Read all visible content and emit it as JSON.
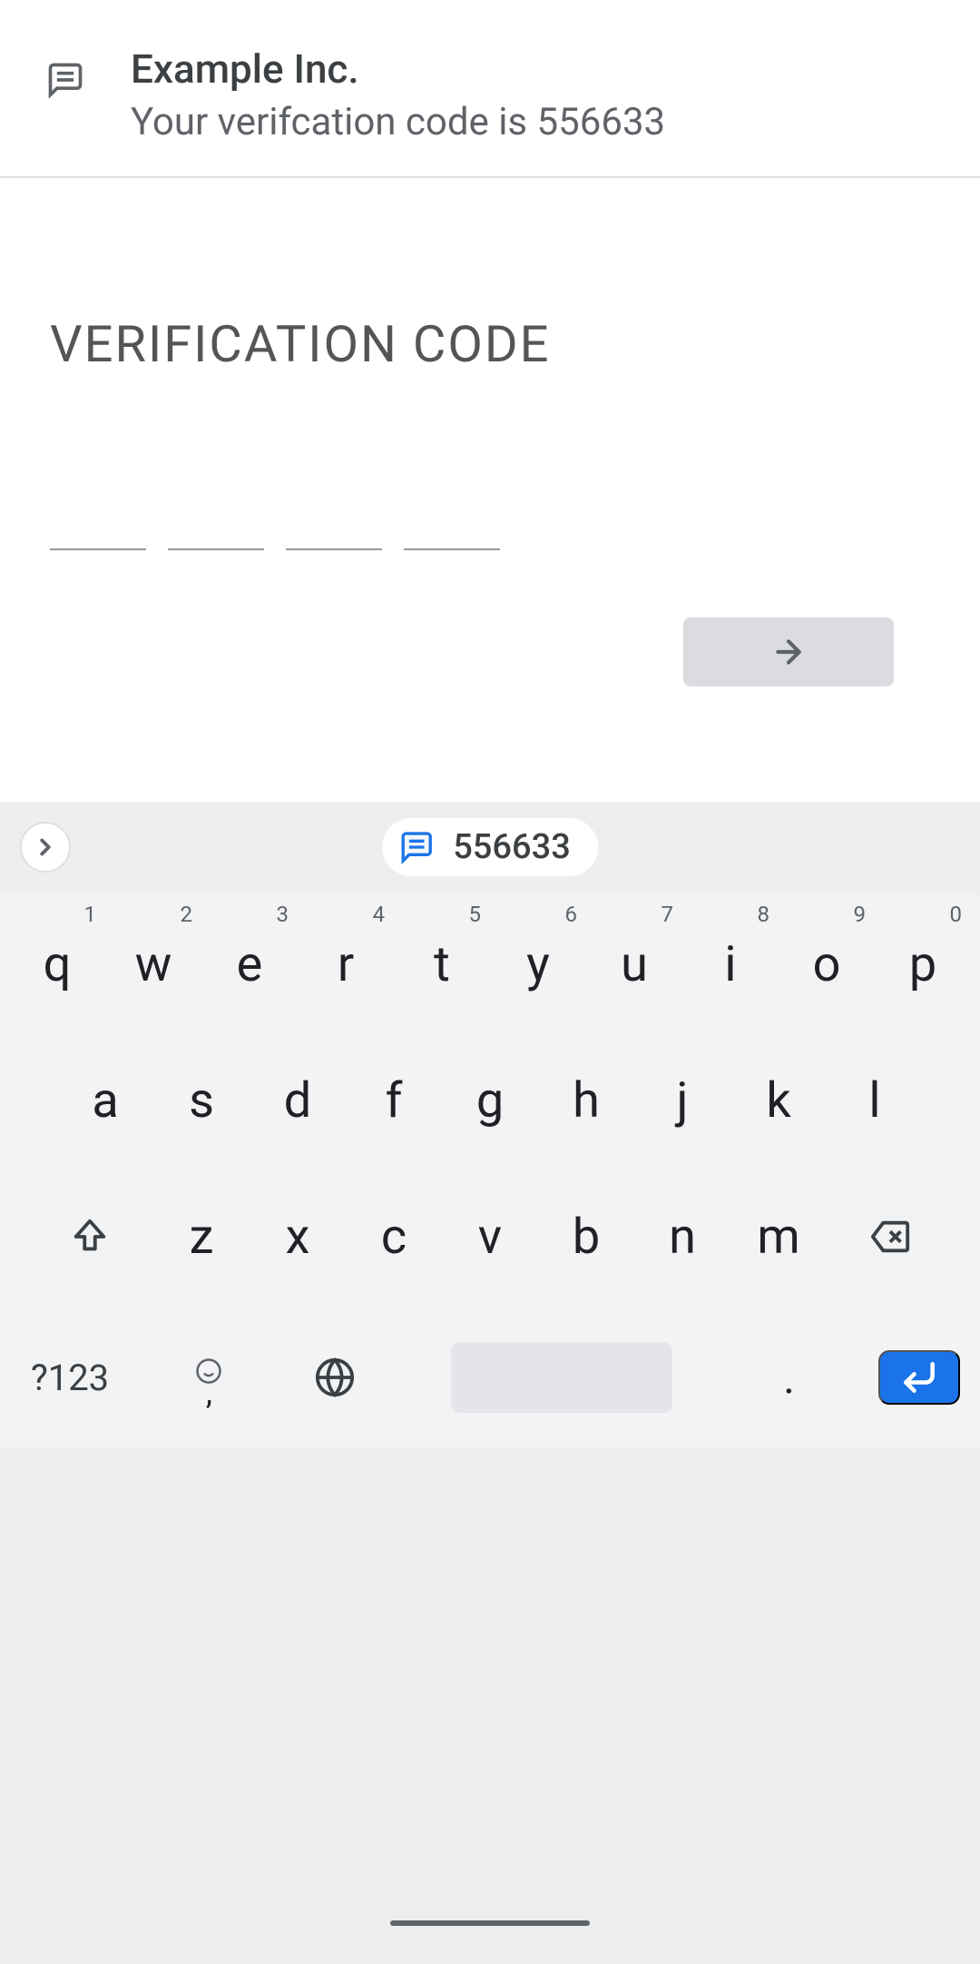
{
  "notification": {
    "sender": "Example Inc.",
    "body": "Your verifcation code is 556633"
  },
  "page": {
    "heading": "VERIFICATION CODE"
  },
  "suggestion": {
    "code": "556633"
  },
  "keyboard": {
    "row1": [
      {
        "k": "q",
        "h": "1"
      },
      {
        "k": "w",
        "h": "2"
      },
      {
        "k": "e",
        "h": "3"
      },
      {
        "k": "r",
        "h": "4"
      },
      {
        "k": "t",
        "h": "5"
      },
      {
        "k": "y",
        "h": "6"
      },
      {
        "k": "u",
        "h": "7"
      },
      {
        "k": "i",
        "h": "8"
      },
      {
        "k": "o",
        "h": "9"
      },
      {
        "k": "p",
        "h": "0"
      }
    ],
    "row2": [
      "a",
      "s",
      "d",
      "f",
      "g",
      "h",
      "j",
      "k",
      "l"
    ],
    "row3": [
      "z",
      "x",
      "c",
      "v",
      "b",
      "n",
      "m"
    ],
    "sym": "?123",
    "comma": ",",
    "dot": "."
  }
}
